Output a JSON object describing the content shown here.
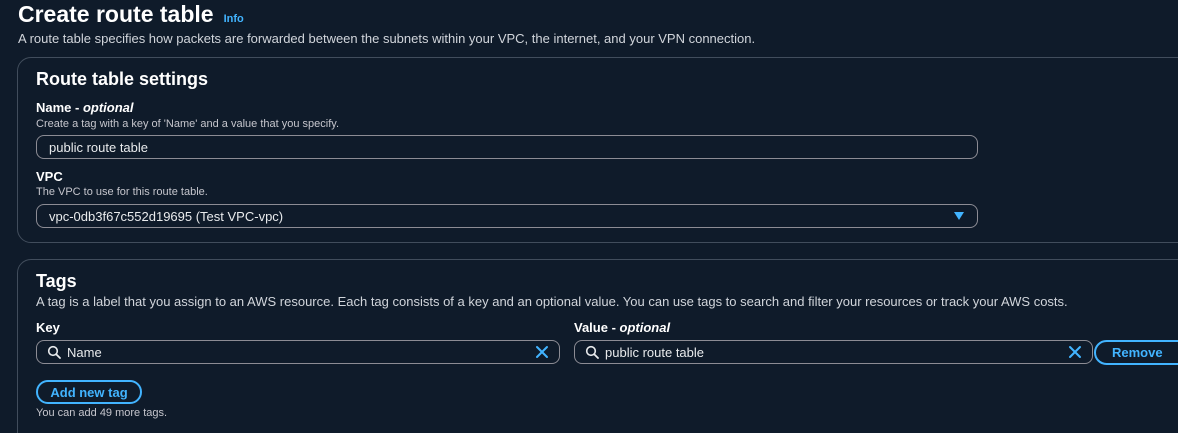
{
  "header": {
    "title": "Create route table",
    "info_link": "Info",
    "description": "A route table specifies how packets are forwarded between the subnets within your VPC, the internet, and your VPN connection."
  },
  "settings": {
    "title": "Route table settings",
    "name_label": "Name - ",
    "name_optional": "optional",
    "name_hint": "Create a tag with a key of 'Name' and a value that you specify.",
    "name_value": "public route table",
    "vpc_label": "VPC",
    "vpc_hint": "The VPC to use for this route table.",
    "vpc_selected": "vpc-0db3f67c552d19695 (Test VPC-vpc)"
  },
  "tags": {
    "title": "Tags",
    "description": "A tag is a label that you assign to an AWS resource. Each tag consists of a key and an optional value. You can use tags to search and filter your resources or track your AWS costs.",
    "key_label": "Key",
    "value_label": "Value - ",
    "value_optional": "optional",
    "rows": [
      {
        "key": "Name",
        "value": "public route table",
        "remove_label": "Remove"
      }
    ],
    "add_button": "Add new tag",
    "footer_hint": "You can add 49 more tags."
  },
  "colors": {
    "background": "#0f1b2a",
    "accent": "#42b4ff",
    "border": "#414d5c",
    "field_border": "#8c8c94"
  },
  "icons": {
    "search": "search-icon",
    "clear": "close-icon",
    "dropdown": "caret-down-icon"
  }
}
